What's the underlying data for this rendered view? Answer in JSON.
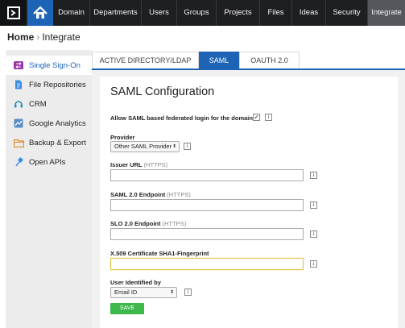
{
  "nav": {
    "items": [
      {
        "label": "Domain"
      },
      {
        "label": "Departments"
      },
      {
        "label": "Users"
      },
      {
        "label": "Groups"
      },
      {
        "label": "Projects"
      },
      {
        "label": "Files"
      },
      {
        "label": "Ideas"
      },
      {
        "label": "Security"
      },
      {
        "label": "Integrate"
      }
    ],
    "active": "Integrate"
  },
  "breadcrumb": {
    "home": "Home",
    "separator": "›",
    "current": "Integrate"
  },
  "sidebar": {
    "items": [
      {
        "label": "Single Sign-On",
        "icon": "sso-arrows-icon"
      },
      {
        "label": "File Repositories",
        "icon": "file-icon"
      },
      {
        "label": "CRM",
        "icon": "headset-icon"
      },
      {
        "label": "Google Analytics",
        "icon": "analytics-chart-icon"
      },
      {
        "label": "Backup & Export",
        "icon": "folder-icon"
      },
      {
        "label": "Open APIs",
        "icon": "api-plug-icon"
      }
    ]
  },
  "tabs": [
    {
      "label": "ACTIVE DIRECTORY/LDAP"
    },
    {
      "label": "SAML"
    },
    {
      "label": "OAUTH 2.0"
    }
  ],
  "saml": {
    "title": "SAML Configuration",
    "allow_label": "Allow SAML based federated login for the domain?",
    "allow_checked": true,
    "provider_label": "Provider",
    "provider_value": "Other SAML Provider",
    "issuer_label": "Issuer URL",
    "issuer_hint": "(HTTPS)",
    "endpoint_label": "SAML 2.0 Endpoint",
    "endpoint_hint": "(HTTPS)",
    "slo_label": "SLO 2.0 Endpoint",
    "slo_hint": "(HTTPS)",
    "cert_label": "X.509 Certificate SHA1-Fingerprint",
    "user_id_label": "User Identified by",
    "user_id_value": "Email ID",
    "save_label": "SAVE",
    "info_glyph": "i",
    "check_glyph": "✓",
    "dropdown_glyph": "⬍"
  },
  "colors": {
    "topbar": "#1e1f21",
    "accent": "#1d63b6",
    "save": "#3cb94a",
    "focus": "#e7c54a"
  }
}
